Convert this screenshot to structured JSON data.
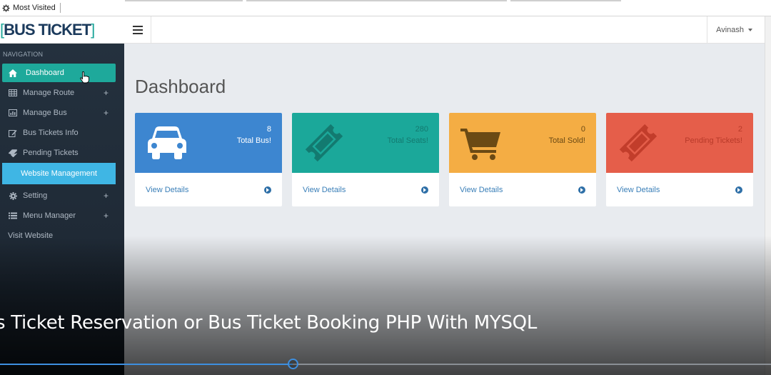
{
  "browser": {
    "bookmark_label": "Most Visited",
    "bookmark_icon": "gear-icon"
  },
  "header": {
    "brand_open": "[",
    "brand_text": "BUS TICKET",
    "brand_close": "]",
    "menu_toggle_icon": "hamburger-icon",
    "user_name": "Avinash"
  },
  "sidebar": {
    "heading": "NAVIGATION",
    "items": [
      {
        "label": "Dashboard",
        "icon": "home-icon",
        "active": true
      },
      {
        "label": "Manage Route",
        "icon": "table-icon",
        "expandable": "+"
      },
      {
        "label": "Manage Bus",
        "icon": "bar-chart-icon",
        "expandable": "+"
      },
      {
        "label": "Bus Tickets Info",
        "icon": "edit-icon"
      },
      {
        "label": "Pending Tickets",
        "icon": "tag-icon"
      },
      {
        "label": "Website Management",
        "highlight": true
      },
      {
        "label": "Setting",
        "icon": "gear-icon",
        "expandable": "+"
      },
      {
        "label": "Menu Manager",
        "icon": "list-icon",
        "expandable": "+"
      },
      {
        "label": "Visit Website"
      }
    ]
  },
  "main": {
    "title": "Dashboard",
    "cards": [
      {
        "count": "8",
        "label": "Total Bus!",
        "link": "View Details",
        "icon": "car-icon",
        "color": "#3d86d0"
      },
      {
        "count": "280",
        "label": "Total Seats!",
        "link": "View Details",
        "icon": "ticket-icon",
        "color": "#1ba89a"
      },
      {
        "count": "0",
        "label": "Total Sold!",
        "link": "View Details",
        "icon": "shopping-cart-icon",
        "color": "#f4ad44"
      },
      {
        "count": "2",
        "label": "Pending Tickets!",
        "link": "View Details",
        "icon": "ticket-icon",
        "color": "#e55e4a"
      }
    ]
  },
  "video": {
    "caption": "s Ticket Reservation or Bus Ticket Booking PHP With MYSQL",
    "progress_fraction": 0.38
  }
}
